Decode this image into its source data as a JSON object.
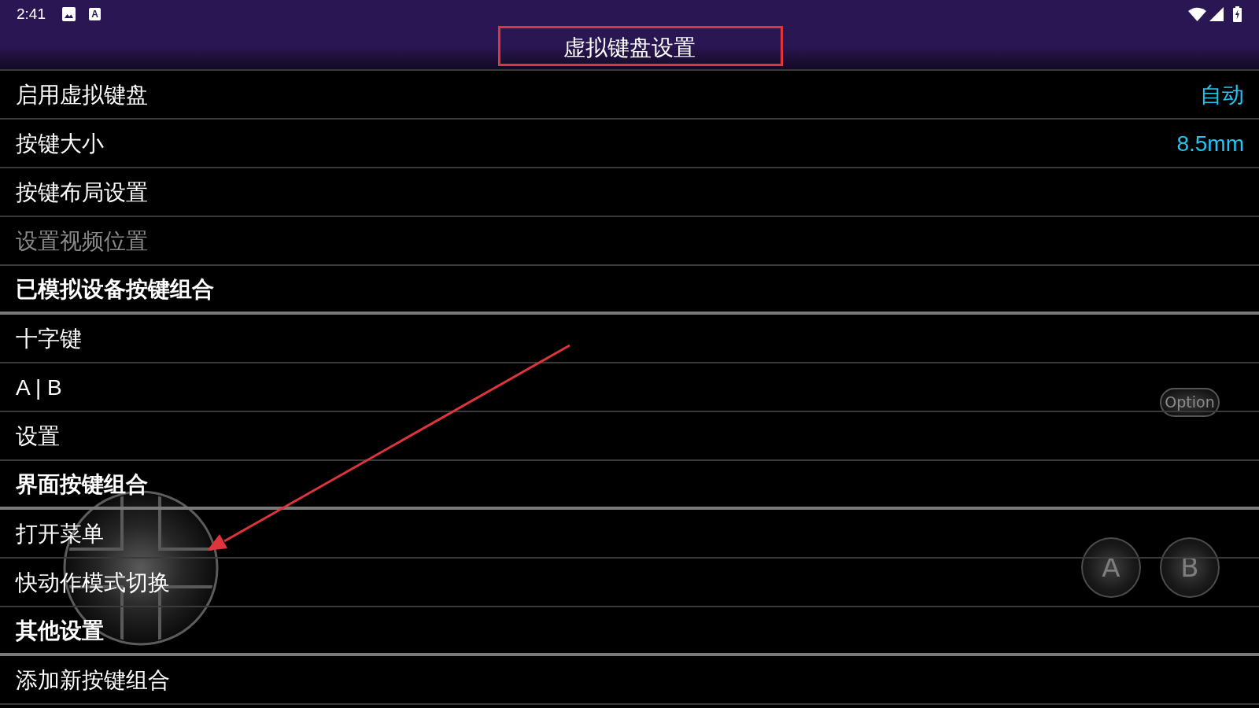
{
  "status_bar": {
    "time": "2:41",
    "input_indicator": "A"
  },
  "title": {
    "text": "虚拟键盘设置",
    "highlighted": true
  },
  "groups": [
    {
      "items": [
        {
          "label": "启用虚拟键盘",
          "value": "自动",
          "disabled": false
        },
        {
          "label": "按键大小",
          "value": "8.5mm",
          "disabled": false
        },
        {
          "label": "按键布局设置",
          "disabled": false
        },
        {
          "label": "设置视频位置",
          "disabled": true
        }
      ]
    },
    {
      "title": "已模拟设备按键组合",
      "items": [
        {
          "label": "十字键",
          "disabled": false
        },
        {
          "label": "A | B",
          "disabled": false
        },
        {
          "label": "设置",
          "disabled": false
        }
      ]
    },
    {
      "title": "界面按键组合",
      "items": [
        {
          "label": "打开菜单",
          "disabled": false
        },
        {
          "label": "快动作模式切换",
          "disabled": false
        }
      ]
    },
    {
      "title": "其他设置",
      "items": [
        {
          "label": "添加新按键组合",
          "disabled": false
        }
      ]
    }
  ],
  "overlay_controls": [
    {
      "kind": "dpad"
    },
    {
      "kind": "pill",
      "label": "Option"
    },
    {
      "kind": "round",
      "label": "A"
    },
    {
      "kind": "round",
      "label": "B"
    }
  ],
  "annotation_arrow": true
}
